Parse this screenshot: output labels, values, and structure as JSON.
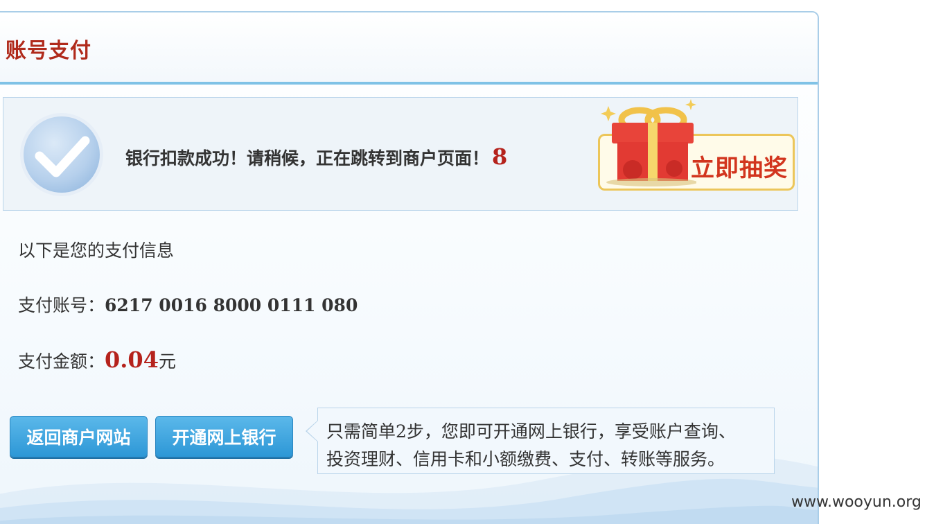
{
  "header": {
    "title": "账号支付"
  },
  "notice": {
    "message": "银行扣款成功！请稍候，正在跳转到商户页面！",
    "countdown": "8",
    "lottery_label": "立即抽奖",
    "icons": {
      "status": "check-circle-icon",
      "lottery": "gift-box-icon"
    }
  },
  "payment_info": {
    "intro": "以下是您的支付信息",
    "account_label": "支付账号：",
    "account_number": "6217 0016 8000 0111 080",
    "amount_label": "支付金额：",
    "amount_value": "0.04",
    "amount_unit": "元"
  },
  "actions": {
    "return_label": "返回商户网站",
    "open_bank_label": "开通网上银行"
  },
  "tip": {
    "line1": "只需简单2步，您即可开通网上银行，享受账户查询、",
    "line2": "投资理财、信用卡和小额缴费、支付、转账等服务。"
  },
  "watermark": "www.wooyun.org",
  "colors": {
    "title_red": "#b02a1b",
    "amount_red": "#b5221c",
    "button_blue": "#2d97d6",
    "header_rule": "#7fc2e6",
    "border_blue": "#a9cde8"
  }
}
